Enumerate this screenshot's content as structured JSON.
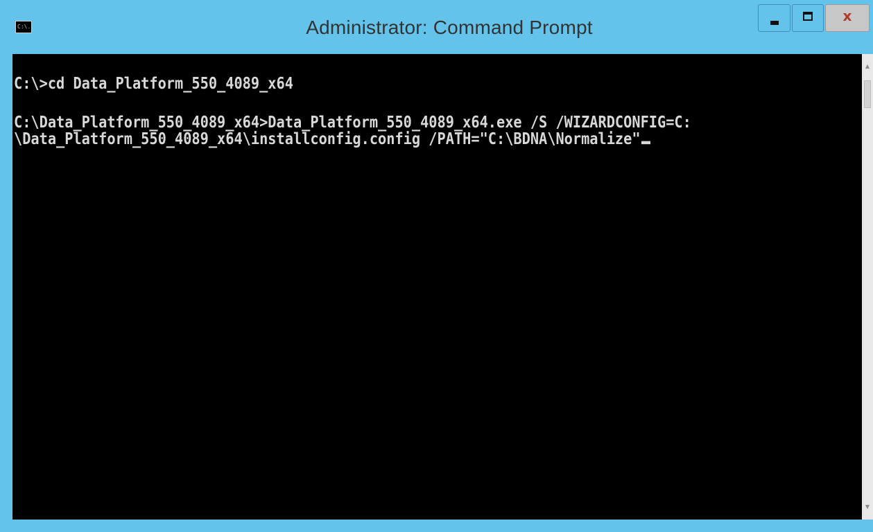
{
  "window": {
    "title": "Administrator: Command Prompt",
    "icon": "cmd-icon",
    "icon_text": "C:\\.",
    "controls": {
      "minimize_icon": "minimize-icon",
      "maximize_icon": "maximize-icon",
      "close_label": "x"
    },
    "colors": {
      "frame": "#63c3ea",
      "console_bg": "#000000",
      "console_text": "#d8d8d8",
      "close_bg": "#c7c7c7"
    }
  },
  "console": {
    "lines": [
      "C:\\>cd Data_Platform_550_4089_x64",
      "C:\\Data_Platform_550_4089_x64>Data_Platform_550_4089_x64.exe /S /WIZARDCONFIG=C:",
      "\\Data_Platform_550_4089_x64\\installconfig.config /PATH=\"C:\\BDNA\\Normalize\""
    ]
  },
  "scrollbar": {
    "up_icon": "scroll-up-arrow-icon",
    "down_icon": "scroll-down-arrow-icon",
    "up_glyph": "▲",
    "down_glyph": "▼"
  }
}
